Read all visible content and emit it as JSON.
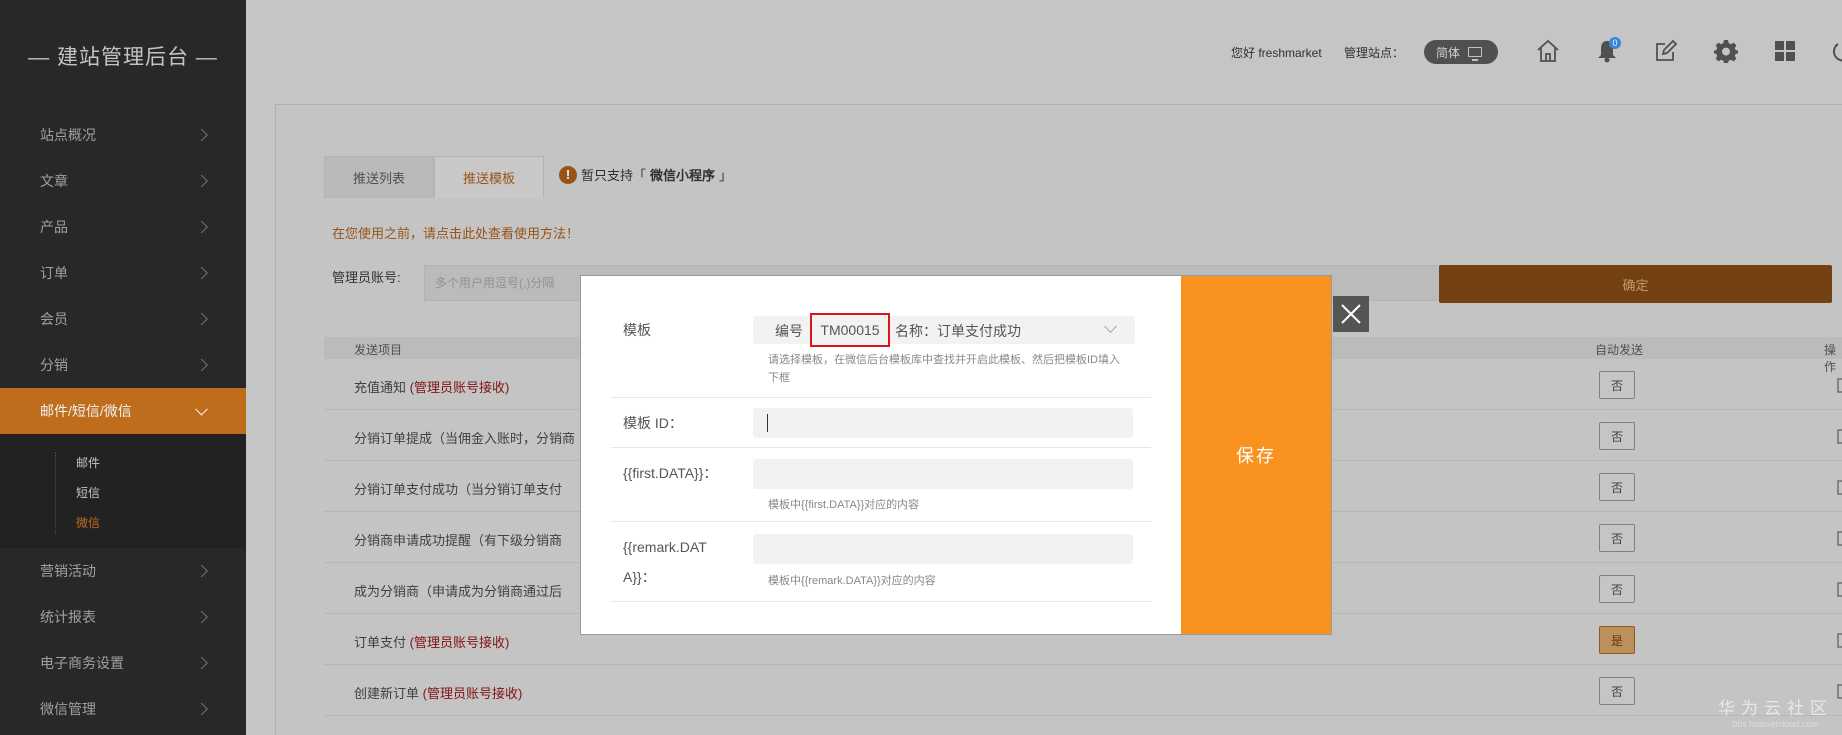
{
  "sidebar": {
    "brand": "— 建站管理后台 —",
    "items": [
      {
        "label": "站点概况"
      },
      {
        "label": "文章"
      },
      {
        "label": "产品"
      },
      {
        "label": "订单"
      },
      {
        "label": "会员"
      },
      {
        "label": "分销"
      },
      {
        "label": "邮件/短信/微信"
      }
    ],
    "subitems": [
      {
        "label": "邮件"
      },
      {
        "label": "短信"
      },
      {
        "label": "微信"
      }
    ],
    "items_after": [
      {
        "label": "营销活动"
      },
      {
        "label": "统计报表"
      },
      {
        "label": "电子商务设置"
      },
      {
        "label": "微信管理"
      }
    ]
  },
  "header": {
    "greeting": "您好 freshmarket",
    "site_label": "管理站点：",
    "lang": "简体",
    "notification_count": "0",
    "icons": [
      "home-icon",
      "bell-icon",
      "edit-icon",
      "gear-icon",
      "grid-icon",
      "power-icon"
    ]
  },
  "main": {
    "tabs": [
      {
        "label": "推送列表"
      },
      {
        "label": "推送模板"
      }
    ],
    "notice_prefix": "暂只支持「",
    "notice_bold": "微信小程序",
    "notice_suffix": "」",
    "usage_link": "在您使用之前，请点击此处查看使用方法！",
    "admin_label": "管理员账号:",
    "admin_placeholder": "多个用户用逗号(,)分隔",
    "confirm_label": "确定",
    "col_item": "发送项目",
    "col_auto": "自动发送",
    "col_op": "操作",
    "rows": [
      {
        "name": "充值通知 ",
        "tag": "(管理员账号接收)",
        "auto": "否"
      },
      {
        "name": "分销订单提成（当佣金入账时，分销商",
        "tag": "",
        "auto": "否"
      },
      {
        "name": "分销订单支付成功（当分销订单支付",
        "tag": "",
        "auto": "否"
      },
      {
        "name": "分销商申请成功提醒（有下级分销商",
        "tag": "",
        "auto": "否"
      },
      {
        "name": "成为分销商（申请成为分销商通过后",
        "tag": "",
        "auto": "否"
      },
      {
        "name": "订单支付 ",
        "tag": "(管理员账号接收)",
        "auto": "是"
      },
      {
        "name": "创建新订单 ",
        "tag": "(管理员账号接收)",
        "auto": "否"
      }
    ]
  },
  "modal": {
    "template_label": "模板",
    "code_label": "编号",
    "code_value": "TM00015",
    "name_text": "名称：订单支付成功",
    "template_hint": "请选择模板，在微信后台模板库中查找并开启此模板、然后把模板ID填入下框",
    "template_id_label": "模板 ID：",
    "template_id_value": "",
    "first_label": "{{first.DATA}}：",
    "first_hint": "模板中{{first.DATA}}对应的内容",
    "remark_label_1": "{{remark.DAT",
    "remark_label_2": "A}}：",
    "remark_hint": "模板中{{remark.DATA}}对应的内容",
    "save_label": "保存"
  },
  "watermark": {
    "line1": "华为云社区",
    "line2": "bbs.huaweicloud.com"
  }
}
